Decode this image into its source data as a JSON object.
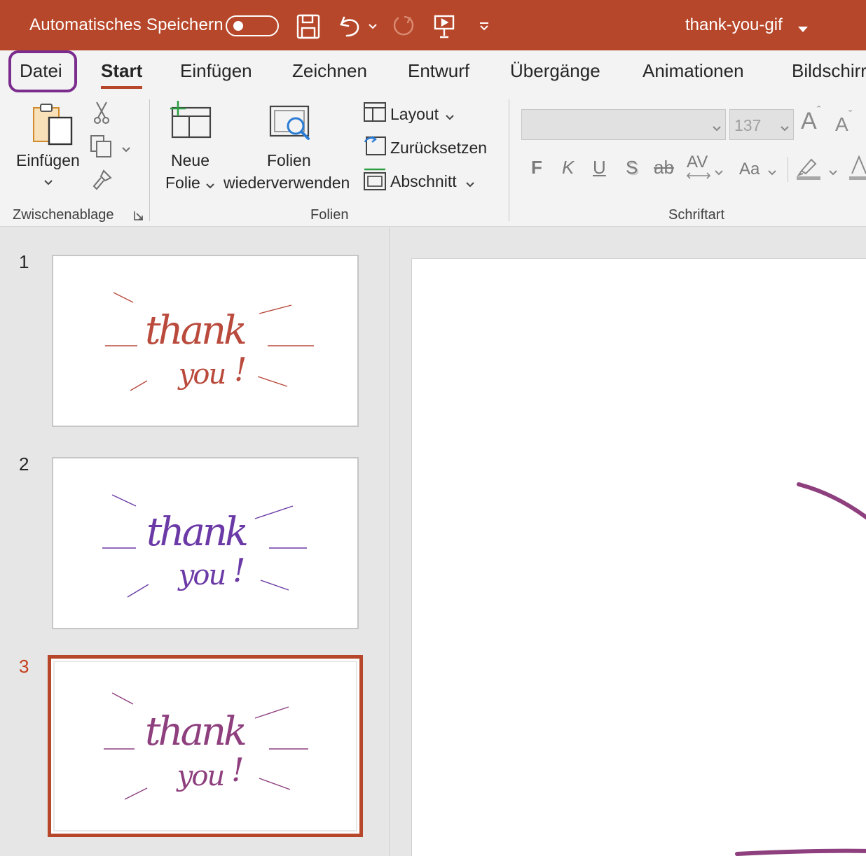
{
  "titlebar": {
    "autosave_label": "Automatisches Speichern",
    "autosave_state": "off",
    "doc_title": "thank-you-gif",
    "icons": [
      "save-icon",
      "undo-icon",
      "redo-icon",
      "present-icon",
      "customize-qat-icon"
    ],
    "background": "#b7472a"
  },
  "tabs": [
    "Datei",
    "Start",
    "Einfügen",
    "Zeichnen",
    "Entwurf",
    "Übergänge",
    "Animationen",
    "Bildschirr"
  ],
  "active_tab": "Start",
  "highlighted_tab": "Datei",
  "ribbon": {
    "clipboard": {
      "paste_label": "Einfügen",
      "group_label": "Zwischenablage"
    },
    "slides": {
      "new_slide_line1": "Neue",
      "new_slide_line2": "Folie",
      "reuse_line1": "Folien",
      "reuse_line2": "wiederverwenden",
      "layout": "Layout",
      "reset": "Zurücksetzen",
      "section": "Abschnitt",
      "group_label": "Folien"
    },
    "font": {
      "font_name": "",
      "font_size": "137",
      "grow": "A",
      "shrink": "A",
      "bold": "F",
      "italic": "K",
      "underline": "U",
      "shadow": "S",
      "strike": "ab",
      "spacing": "AV",
      "case": "Aa",
      "group_label": "Schriftart"
    }
  },
  "slides": [
    {
      "number": "1",
      "line1": "thank",
      "line2": "you",
      "excl": "!",
      "color": "#b94a3c"
    },
    {
      "number": "2",
      "line1": "thank",
      "line2": "you",
      "excl": "!",
      "color": "#6b3aa6"
    },
    {
      "number": "3",
      "line1": "thank",
      "line2": "you",
      "excl": "!",
      "color": "#8e3f7e",
      "selected": true
    }
  ],
  "accent_color": "#b7472a",
  "highlight_color": "#7b2d8e"
}
